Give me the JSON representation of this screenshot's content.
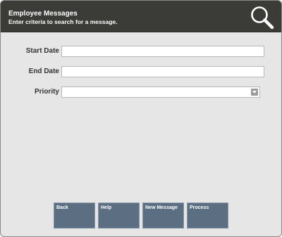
{
  "header": {
    "title": "Employee Messages",
    "subtitle": "Enter criteria to search for a message.",
    "icon": "search-icon"
  },
  "form": {
    "start_date": {
      "label": "Start Date",
      "value": ""
    },
    "end_date": {
      "label": "End Date",
      "value": ""
    },
    "priority": {
      "label": "Priority",
      "value": ""
    }
  },
  "buttons": {
    "back": "Back",
    "help": "Help",
    "new_message": "New Message",
    "process": "Process"
  },
  "colors": {
    "header_bg": "#3b3b38",
    "panel_bg": "#e6e6e6",
    "button_bg": "#5b6e82"
  }
}
